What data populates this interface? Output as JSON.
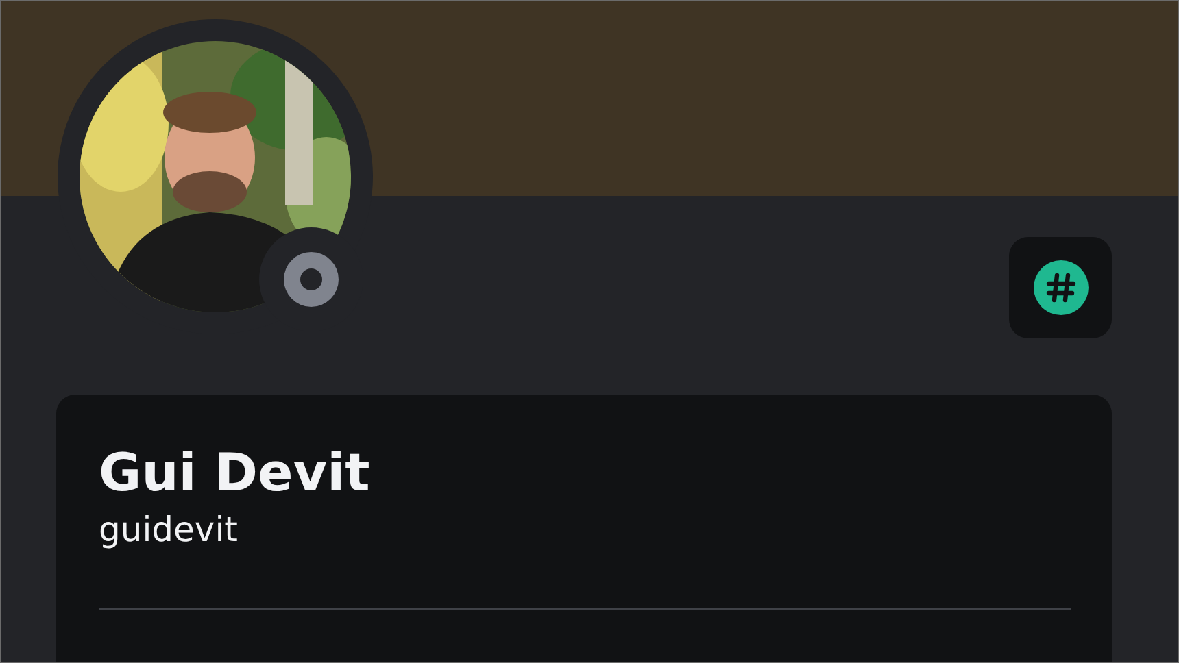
{
  "profile": {
    "online": false,
    "name": "Gui Devit",
    "username": "guidevit"
  }
}
